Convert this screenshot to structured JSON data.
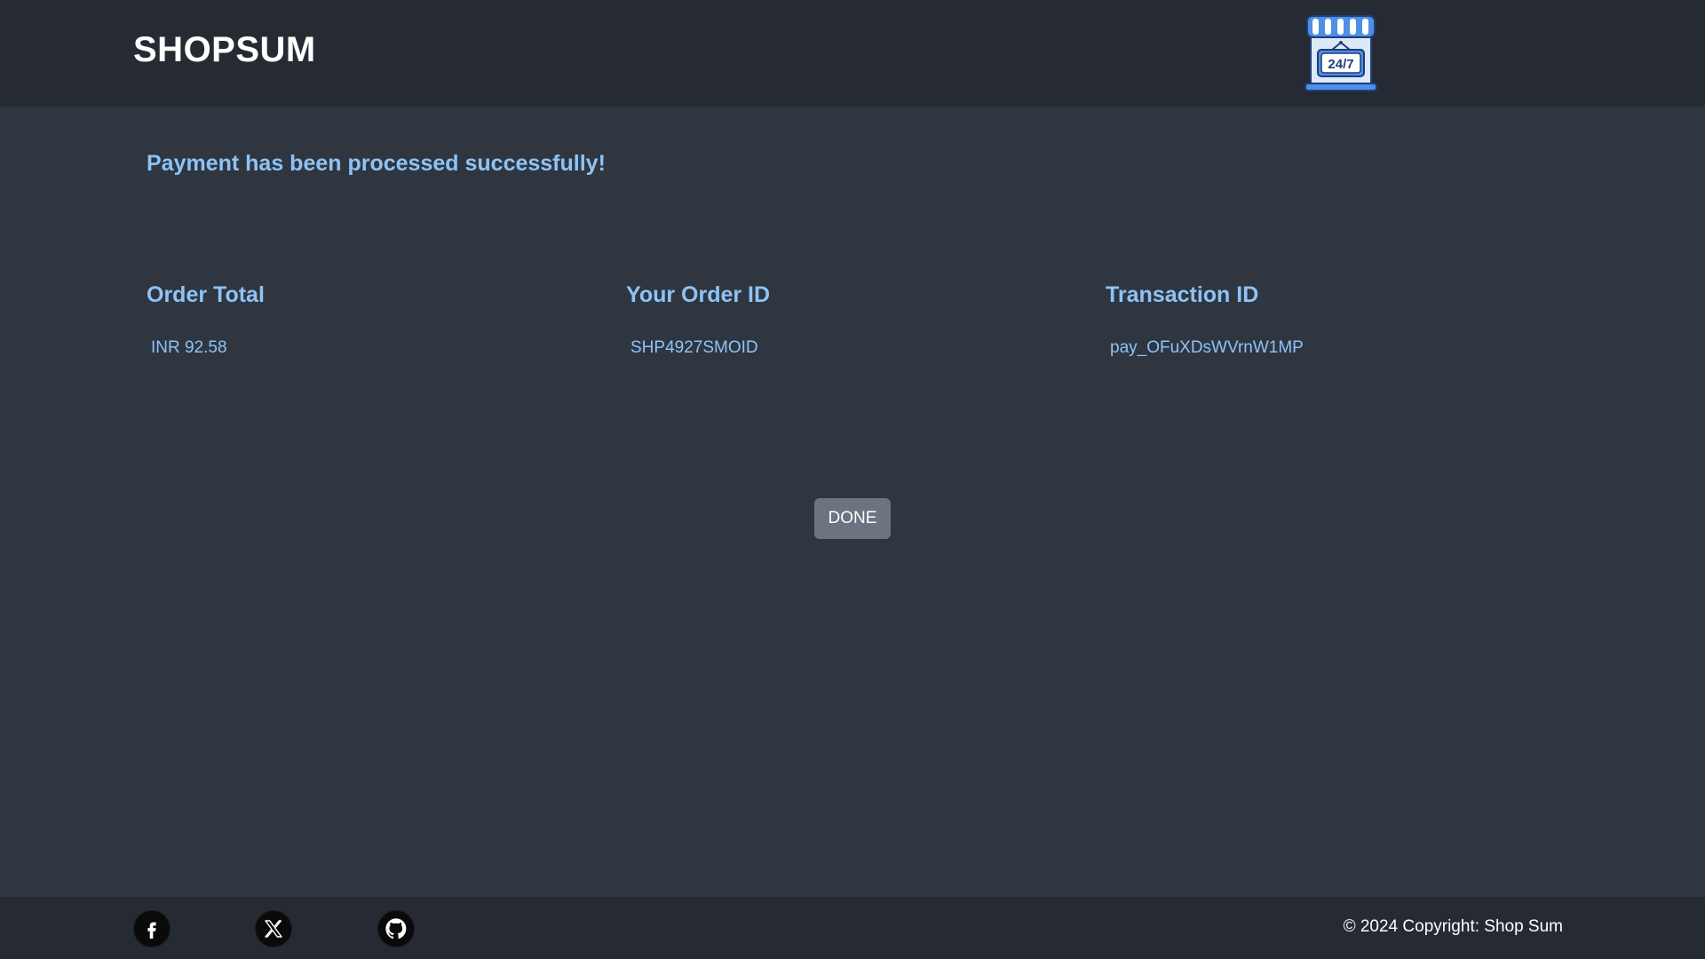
{
  "header": {
    "brand": "SHOPSUM",
    "logo_icon": "storefront-24-7-icon",
    "logo_text": "24/7"
  },
  "main": {
    "success_message": "Payment has been processed successfully!",
    "details": [
      {
        "title": "Order Total",
        "value": "INR 92.58"
      },
      {
        "title": "Your Order ID",
        "value": "SHP4927SMOID"
      },
      {
        "title": "Transaction ID",
        "value": "pay_OFuXDsWVrnW1MP"
      }
    ],
    "done_label": "DONE"
  },
  "footer": {
    "social": [
      {
        "name": "facebook",
        "icon": "facebook-icon"
      },
      {
        "name": "x",
        "icon": "x-twitter-icon"
      },
      {
        "name": "github",
        "icon": "github-icon"
      }
    ],
    "copyright": "© 2024 Copyright: Shop Sum"
  },
  "colors": {
    "header_bg": "#262b33",
    "body_bg": "#2f3640",
    "accent": "#8ec3f5",
    "button_bg": "#6b7480"
  }
}
